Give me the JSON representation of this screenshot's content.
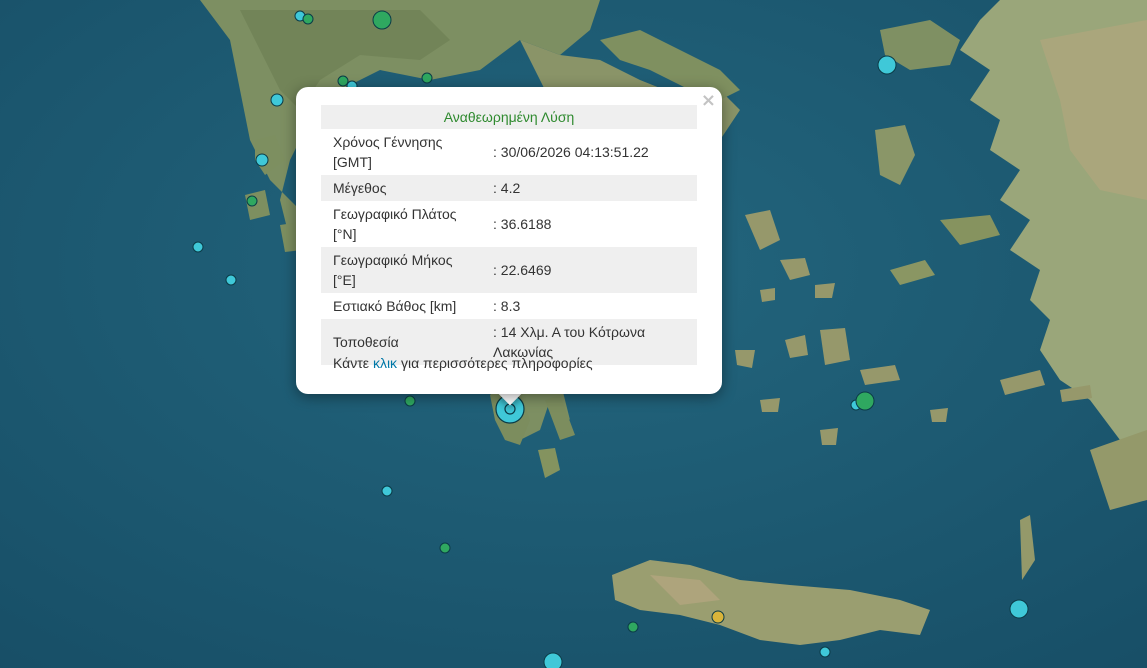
{
  "map": {
    "colors": {
      "sea": "#1e5f76",
      "land": "#8a9a6b",
      "marker_cyan": "#3fc8d8",
      "marker_green": "#2fa860",
      "marker_yellow": "#d9b43a"
    }
  },
  "popup": {
    "close_label": "×",
    "title": "Αναθεωρημένη Λύση",
    "rows": [
      {
        "key": "Χρόνος Γέννησης [GMT]",
        "value": ": 30/06/2026 04:13:51.22"
      },
      {
        "key": "Μέγεθος",
        "value": ": 4.2"
      },
      {
        "key": "Γεωγραφικό Πλάτος [°N]",
        "value": ": 36.6188"
      },
      {
        "key": "Γεωγραφικό Μήκος [°E]",
        "value": ": 22.6469"
      },
      {
        "key": "Εστιακό Βάθος [km]",
        "value": ": 8.3"
      },
      {
        "key": "Τοποθεσία",
        "value": ": 14 Χλμ. Α του Κότρωνα Λακωνίας"
      }
    ],
    "more_prefix": "Κάντε",
    "more_link": "κλικ",
    "more_suffix": "για περισσότερες πληροφορίες"
  },
  "earthquakes": [
    {
      "lat": 36.6188,
      "lon": 22.6469,
      "magnitude": 4.2,
      "category": "cyan",
      "selected": true
    }
  ]
}
